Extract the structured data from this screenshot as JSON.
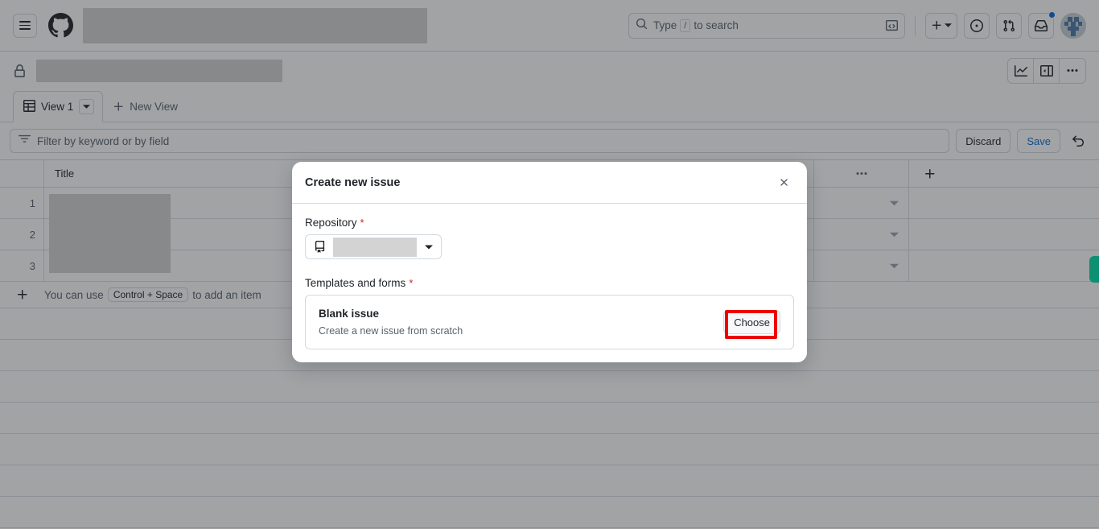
{
  "header": {
    "menu_label": "Open menu",
    "logo_label": "GitHub",
    "search": {
      "placeholder_prefix": "Type",
      "key": "/",
      "placeholder_suffix": "to search"
    },
    "icons": {
      "search": "search-icon",
      "command_palette": "terminal-icon",
      "create_new": "plus-icon",
      "issues": "issue-opened-icon",
      "pull_requests": "git-pull-request-icon",
      "inbox": "inbox-icon",
      "avatar": "user-avatar"
    },
    "notification_dot_color": "#0969da"
  },
  "project": {
    "visibility_icon": "lock-icon",
    "actions": [
      {
        "name": "insights-button",
        "icon": "graph-icon"
      },
      {
        "name": "toggle-sidebar-button",
        "icon": "sidebar-expand-icon"
      },
      {
        "name": "project-more-menu-button",
        "icon": "kebab-horizontal-icon"
      }
    ]
  },
  "tabs": {
    "current": {
      "label": "View 1",
      "icon": "table-icon"
    },
    "new_view_label": "New View"
  },
  "filter": {
    "placeholder": "Filter by keyword or by field",
    "icon": "filter-icon",
    "discard_label": "Discard",
    "save_label": "Save",
    "save_color": "#0969da",
    "undo_icon": "undo-icon"
  },
  "table": {
    "columns": {
      "title": "Title",
      "menu": "•••",
      "add_column": "+"
    },
    "rows": [
      {
        "number": "1",
        "title": "",
        "caret": "chevron-down-icon"
      },
      {
        "number": "2",
        "title": "",
        "caret": "chevron-down-icon"
      },
      {
        "number": "3",
        "title": "",
        "caret": "chevron-down-icon"
      }
    ],
    "add_item": {
      "plus": "+",
      "text_before": "You can use",
      "shortcut": "Control + Space",
      "text_after": "to add an item"
    },
    "status_indicator_color": "#00dca5"
  },
  "modal": {
    "title": "Create new issue",
    "close_icon": "close-icon",
    "repository": {
      "label": "Repository",
      "required": "*",
      "icon": "repo-icon",
      "value": "",
      "caret": "triangle-down-icon"
    },
    "templates": {
      "label": "Templates and forms",
      "required": "*",
      "items": [
        {
          "name": "Blank issue",
          "description": "Create a new issue from scratch",
          "action_label": "Choose"
        }
      ]
    },
    "annotation_color": "#ee0000"
  }
}
